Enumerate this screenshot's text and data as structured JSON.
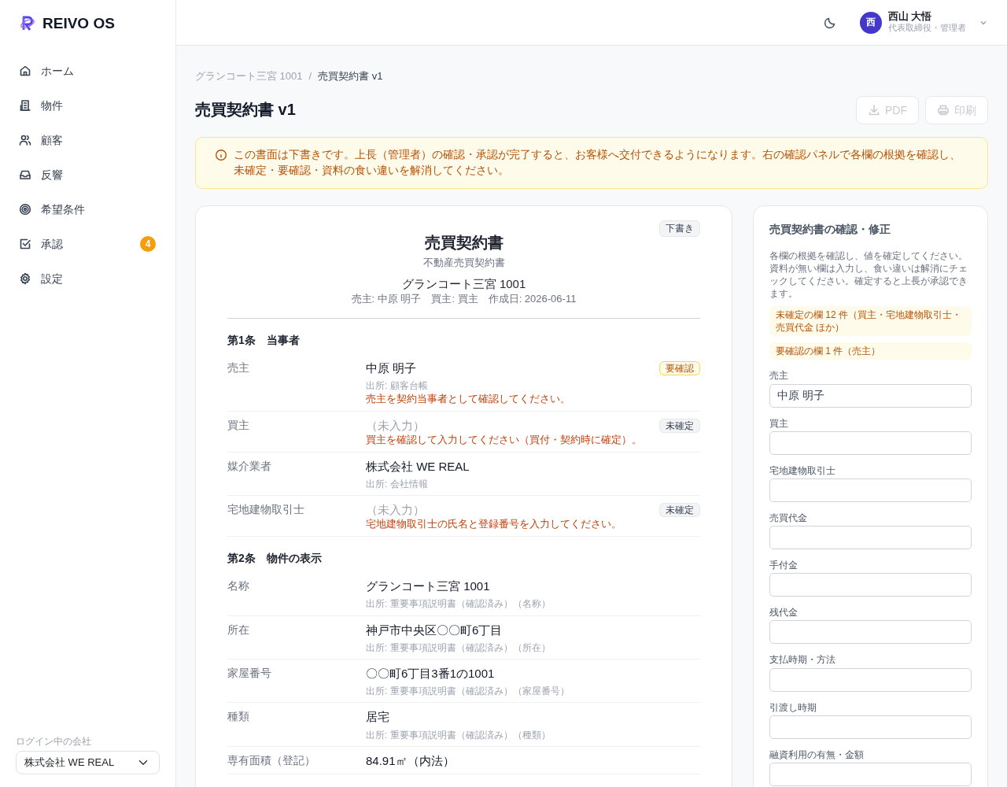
{
  "app": {
    "name": "REIVO OS"
  },
  "sidebar": {
    "items": [
      {
        "label": "ホーム",
        "selected": false
      },
      {
        "label": "物件",
        "selected": false
      },
      {
        "label": "顧客",
        "selected": false
      },
      {
        "label": "反響",
        "selected": false
      },
      {
        "label": "希望条件",
        "selected": false
      },
      {
        "label": "承認",
        "selected": false,
        "badge": "4"
      },
      {
        "label": "設定",
        "selected": false
      }
    ],
    "company_label": "ログイン中の会社",
    "company": "株式会社 WE REAL"
  },
  "header": {
    "user": {
      "initial": "西",
      "name": "西山 大悟",
      "role": "代表取締役・管理者"
    }
  },
  "breadcrumb": {
    "items": [
      "グランコート三宮 1001",
      "売買契約書 v1"
    ],
    "separator": "/"
  },
  "page_title": "売買契約書 v1",
  "actions": [
    {
      "label": "PDF",
      "disabled": true
    },
    {
      "label": "印刷",
      "disabled": true
    }
  ],
  "alert": "この書面は下書きです。上長（管理者）の確認・承認が完了すると、お客様へ交付できるようになります。右の確認パネルで各欄の根拠を確認し、未確定・要確認・資料の食い違いを解消してください。",
  "document": {
    "status": "下書き",
    "title": "売買契約書",
    "subtitle": "不動産売買契約書",
    "property": "グランコート三宮 1001",
    "meta": "売主: 中原 明子　買主: 買主　作成日: 2026-06-11",
    "sections": [
      {
        "heading": "第1条　当事者",
        "rows": [
          {
            "label": "売主",
            "value": "中原 明子",
            "empty": false,
            "source": "出所: 顧客台帳",
            "note": "売主を契約当事者として確認してください。",
            "badge": {
              "kind": "warning",
              "label": "要確認"
            }
          },
          {
            "label": "買主",
            "value": "（未入力）",
            "empty": true,
            "note": "買主を確認して入力してください（買付・契約時に確定）。",
            "badge": {
              "kind": "neutral",
              "label": "未確定"
            }
          },
          {
            "label": "媒介業者",
            "value": "株式会社 WE REAL",
            "empty": false,
            "source": "出所: 会社情報"
          },
          {
            "label": "宅地建物取引士",
            "value": "（未入力）",
            "empty": true,
            "note": "宅地建物取引士の氏名と登録番号を入力してください。",
            "badge": {
              "kind": "neutral",
              "label": "未確定"
            }
          }
        ]
      },
      {
        "heading": "第2条　物件の表示",
        "rows": [
          {
            "label": "名称",
            "value": "グランコート三宮 1001",
            "empty": false,
            "source": "出所: 重要事項説明書（確認済み）（名称）"
          },
          {
            "label": "所在",
            "value": "神戸市中央区〇〇町6丁目",
            "empty": false,
            "source": "出所: 重要事項説明書（確認済み）（所在）"
          },
          {
            "label": "家屋番号",
            "value": "〇〇町6丁目3番1の1001",
            "empty": false,
            "source": "出所: 重要事項説明書（確認済み）（家屋番号）"
          },
          {
            "label": "種類",
            "value": "居宅",
            "empty": false,
            "source": "出所: 重要事項説明書（確認済み）（種類）"
          },
          {
            "label": "専有面積（登記）",
            "value": "84.91㎡（内法）",
            "empty": false
          }
        ]
      }
    ]
  },
  "review": {
    "title": "売買契約書の確認・修正",
    "description": "各欄の根拠を確認し、値を確定してください。資料が無い欄は入力し、食い違いは解消にチェックしてください。確定すると上長が承認できます。",
    "notices": [
      "未確定の欄 12 件（買主・宅地建物取引士・売買代金 ほか）",
      "要確認の欄 1 件（売主）"
    ],
    "fields": [
      {
        "label": "売主",
        "value": "中原 明子"
      },
      {
        "label": "買主"
      },
      {
        "label": "宅地建物取引士"
      },
      {
        "label": "売買代金"
      },
      {
        "label": "手付金"
      },
      {
        "label": "残代金"
      },
      {
        "label": "支払時期・方法"
      },
      {
        "label": "引渡し時期"
      },
      {
        "label": "融資利用の有無・金額"
      }
    ]
  }
}
